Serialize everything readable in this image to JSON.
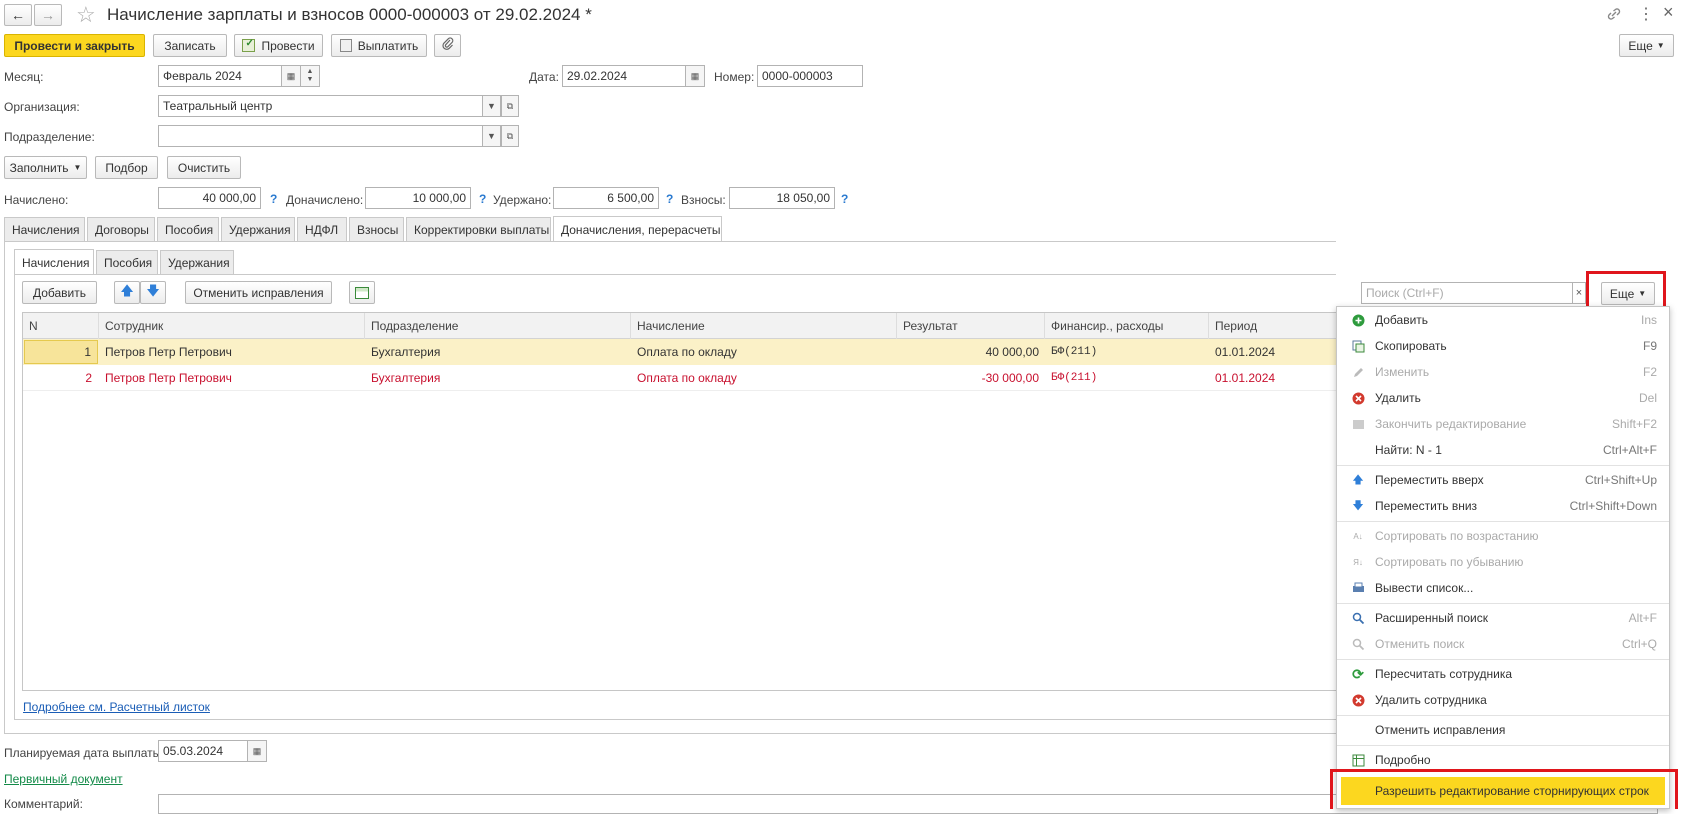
{
  "header": {
    "title": "Начисление зарплаты и взносов 0000-000003 от 29.02.2024 *",
    "back_icon": "←",
    "forward_icon": "→",
    "star_icon": "☆",
    "link_icon": "🔗",
    "more_icon": "⋮",
    "close_icon": "×"
  },
  "toolbar": {
    "post_close": "Провести и закрыть",
    "save": "Записать",
    "post": "Провести",
    "pay": "Выплатить",
    "more": "Еще"
  },
  "fields": {
    "month_label": "Месяц:",
    "month_value": "Февраль 2024",
    "date_label": "Дата:",
    "date_value": "29.02.2024",
    "number_label": "Номер:",
    "number_value": "0000-000003",
    "org_label": "Организация:",
    "org_value": "Театральный центр",
    "dept_label": "Подразделение:",
    "dept_value": ""
  },
  "actions": {
    "fill": "Заполнить",
    "select": "Подбор",
    "clear": "Очистить"
  },
  "totals": {
    "accrued_label": "Начислено:",
    "accrued_value": "40 000,00",
    "extra_label": "Доначислено:",
    "extra_value": "10 000,00",
    "withheld_label": "Удержано:",
    "withheld_value": "6 500,00",
    "contrib_label": "Взносы:",
    "contrib_value": "18 050,00",
    "help": "?"
  },
  "tabs": [
    "Начисления",
    "Договоры",
    "Пособия",
    "Удержания",
    "НДФЛ",
    "Взносы",
    "Корректировки выплаты",
    "Доначисления, перерасчеты"
  ],
  "subtabs": [
    "Начисления",
    "Пособия",
    "Удержания"
  ],
  "table_toolbar": {
    "add": "Добавить",
    "cancel_corrections": "Отменить исправления",
    "search_placeholder": "Поиск (Ctrl+F)",
    "more": "Еще"
  },
  "table": {
    "columns": [
      "N",
      "Сотрудник",
      "Подразделение",
      "Начисление",
      "Результат",
      "Финансир., расходы",
      "Период"
    ],
    "rows": [
      {
        "n": "1",
        "employee": "Петров Петр Петрович",
        "dept": "Бухгалтерия",
        "accrual": "Оплата по окладу",
        "result": "40 000,00",
        "finance": "БФ(211)",
        "period": "01.01.2024"
      },
      {
        "n": "2",
        "employee": "Петров Петр Петрович",
        "dept": "Бухгалтерия",
        "accrual": "Оплата по окладу",
        "result": "-30 000,00",
        "finance": "БФ(211)",
        "period": "01.01.2024"
      }
    ]
  },
  "footer": {
    "payslip_link": "Подробнее см. Расчетный листок",
    "pay_date_label": "Планируемая дата выплаты:",
    "pay_date_value": "05.03.2024",
    "primary_doc_link": "Первичный документ",
    "comment_label": "Комментарий:"
  },
  "menu": {
    "items": [
      {
        "label": "Добавить",
        "key": "Ins"
      },
      {
        "label": "Скопировать",
        "key": "F9"
      },
      {
        "label": "Изменить",
        "key": "F2"
      },
      {
        "label": "Удалить",
        "key": "Del"
      },
      {
        "label": "Закончить редактирование",
        "key": "Shift+F2"
      },
      {
        "label": "Найти: N - 1",
        "key": "Ctrl+Alt+F"
      },
      {
        "label": "Переместить вверх",
        "key": "Ctrl+Shift+Up"
      },
      {
        "label": "Переместить вниз",
        "key": "Ctrl+Shift+Down"
      },
      {
        "label": "Сортировать по возрастанию",
        "key": ""
      },
      {
        "label": "Сортировать по убыванию",
        "key": ""
      },
      {
        "label": "Вывести список...",
        "key": ""
      },
      {
        "label": "Расширенный поиск",
        "key": "Alt+F"
      },
      {
        "label": "Отменить поиск",
        "key": "Ctrl+Q"
      },
      {
        "label": "Пересчитать сотрудника",
        "key": ""
      },
      {
        "label": "Удалить сотрудника",
        "key": ""
      },
      {
        "label": "Отменить исправления",
        "key": ""
      },
      {
        "label": "Подробно",
        "key": ""
      },
      {
        "label": "Разрешить редактирование сторнирующих строк",
        "key": ""
      }
    ]
  },
  "colors": {
    "accent_yellow": "#fcd71f",
    "selected_row": "#fbf1c7",
    "storno_red": "#c8102e",
    "highlight_box": "#e0161c",
    "link_blue": "#1a5db6"
  }
}
